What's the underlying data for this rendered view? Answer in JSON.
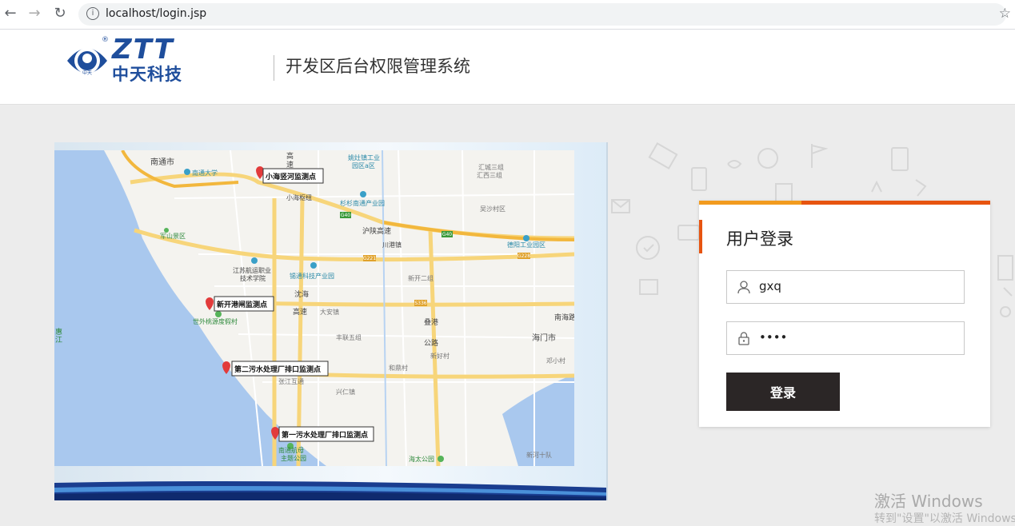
{
  "browser": {
    "url": "localhost/login.jsp",
    "back_icon": "arrow-left-icon",
    "forward_icon": "arrow-right-icon",
    "reload_icon": "reload-icon",
    "info_icon": "info-icon",
    "bookmark_icon": "star-icon"
  },
  "header": {
    "logo_brand": "ZTT",
    "logo_cn": "中天科技",
    "logo_small": "中天",
    "logo_reg": "®",
    "system_title": "开发区后台权限管理系统"
  },
  "map": {
    "markers": [
      {
        "label": "小海竖河监测点"
      },
      {
        "label": "新开港闸监测点"
      },
      {
        "label": "第二污水处理厂排口监测点"
      },
      {
        "label": "第一污水处理厂排口监测点"
      }
    ],
    "place_labels": {
      "nantong": "南通市",
      "ntu": "南通大学",
      "xiaohai": "小海枢纽",
      "gao": "高",
      "su": "速",
      "jiangsu": "江苏航运职业",
      "jiangsu2": "技术学院",
      "xixin": "锡通科技产业园",
      "junshan": "军山景区",
      "shiwai": "世外桃源度假村",
      "chuangang": "川港镇",
      "shanhai": "沈海",
      "gaosu2": "高速",
      "daan": "大安镇",
      "zhongxin": "丰联五组",
      "zhangjiang": "张江互通",
      "zhongxing": "兴仁镇",
      "xinkai": "新开二组",
      "diegang": "叠港",
      "gonglu": "公路",
      "xinhao": "新好村",
      "hailong": "和鼎村",
      "haimen": "海门市",
      "nanhai": "南海路",
      "huoqi": "沪陕高速",
      "yaozhan": "姚灶镇工业",
      "yaozhan2": "园区a区",
      "shanshan": "杉杉南通产业园",
      "huicheng": "汇城三组",
      "huicheng2": "汇西三组",
      "wusha": "吴沙村区",
      "dechi": "德阳工业园区",
      "nantonghang": "南通航母",
      "zhuti": "主题公园",
      "haitai": "海太公园",
      "xinhe": "新河十队",
      "dengxiao": "邓小村",
      "g40": "G40",
      "g221": "G221",
      "g228": "G228",
      "s336": "S336",
      "g40b": "G40",
      "hui": "惠",
      "jiang": "江"
    }
  },
  "login": {
    "title": "用户登录",
    "username_value": "gxq",
    "password_value": "1234",
    "submit_label": "登录",
    "user_icon": "user-icon",
    "lock_icon": "lock-icon"
  },
  "watermark": {
    "line1": "激活 Windows",
    "line2": "转到\"设置\"以激活 Windows"
  },
  "colors": {
    "accent_orange": "#f29b1e",
    "accent_red": "#e75410",
    "button_dark": "#2b2626",
    "logo_blue": "#1f4e9c"
  }
}
